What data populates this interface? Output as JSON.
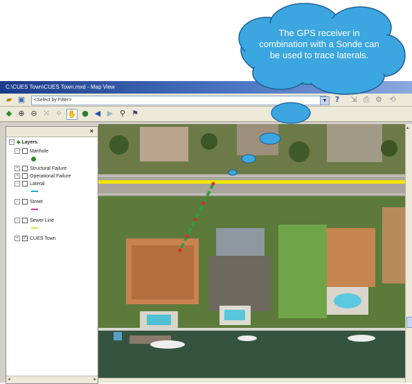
{
  "window": {
    "title": "C:\\CUES Town\\CUES Town.mxd - Map View"
  },
  "toolbar": {
    "select_placeholder": "<Select by Filter>",
    "select_arrow_icon": "chevron-down-icon",
    "tools_row1": [
      "open-icon",
      "add-data-icon"
    ],
    "tools_row1_right": [
      "help-icon",
      "export-icon",
      "print-icon",
      "settings-icon"
    ],
    "tools_row2": [
      "layer-icon",
      "zoom-in-icon",
      "zoom-out-icon",
      "full-extent-icon",
      "fixed-zoom-icon",
      "pan-icon",
      "globe-icon",
      "back-icon",
      "forward-icon",
      "find-icon",
      "identify-icon"
    ]
  },
  "toc": {
    "close_label": "×",
    "root_label": "Layers",
    "layers": [
      {
        "label": "Manhole",
        "checked": false,
        "symbol_color": "#2e8b2e"
      },
      {
        "label": "Structural Failure",
        "checked": false,
        "symbol_color": ""
      },
      {
        "label": "Operational Failure",
        "checked": false,
        "symbol_color": ""
      },
      {
        "label": "Lateral",
        "checked": false,
        "symbol_color": "#2aa2d6"
      },
      {
        "label": "Street",
        "checked": false,
        "symbol_color": "#d63aa3"
      },
      {
        "label": "Sewer Line",
        "checked": false,
        "symbol_color": "#e6df3a"
      },
      {
        "label": "CUES Town",
        "checked": true,
        "symbol_color": ""
      }
    ]
  },
  "map": {
    "street_line_color": "#f2e600",
    "lateral_trace_color": "#2f9e3a",
    "trace_point_color": "#e0262b"
  },
  "callout": {
    "text": "The GPS receiver in combination with a Sonde can be used to trace laterals.",
    "fill_color": "#3ba6e0"
  }
}
